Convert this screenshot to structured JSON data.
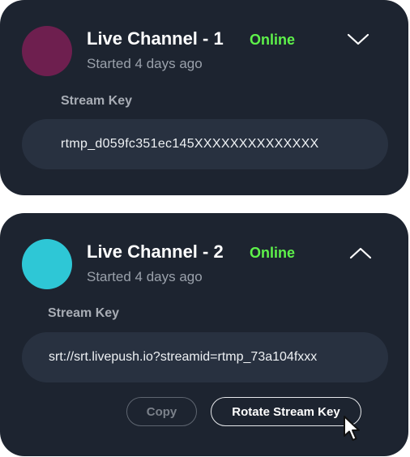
{
  "colors": {
    "card_bg": "#1d2430",
    "field_bg": "#283140",
    "status_online": "#5ef24a"
  },
  "channels": [
    {
      "title": "Live Channel - 1",
      "status": "Online",
      "started": "Started 4 days ago",
      "avatar_color": "#6e1f4f",
      "expand_icon": "chevron-down-icon",
      "stream_key_label": "Stream Key",
      "stream_key_value": "rtmp_d059fc351ec145XXXXXXXXXXXXXX"
    },
    {
      "title": "Live Channel - 2",
      "status": "Online",
      "started": "Started 4 days ago",
      "avatar_color": "#2ec7d6",
      "expand_icon": "chevron-up-icon",
      "stream_key_label": "Stream Key",
      "stream_key_value": "srt://srt.livepush.io?streamid=rtmp_73a104fxxx",
      "buttons": {
        "copy_label": "Copy",
        "rotate_label": "Rotate Stream Key"
      }
    }
  ],
  "cursor_icon": "mouse-pointer-icon"
}
